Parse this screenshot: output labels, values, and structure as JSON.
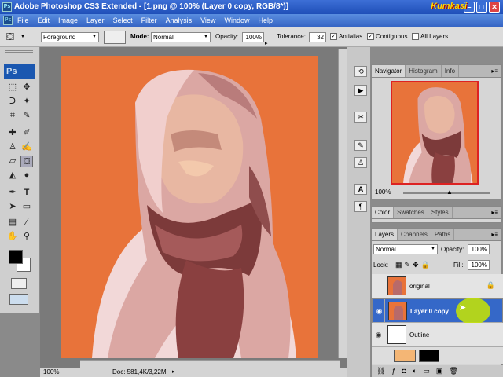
{
  "window": {
    "title": "Adobe Photoshop CS3 Extended - [1.png @ 100% (Layer 0 copy, RGB/8*)]",
    "app_icon": "Ps",
    "watermark": "Kumkasi"
  },
  "menu": [
    "File",
    "Edit",
    "Image",
    "Layer",
    "Select",
    "Filter",
    "Analysis",
    "View",
    "Window",
    "Help"
  ],
  "options": {
    "fill_source": "Foreground",
    "mode_label": "Mode:",
    "mode_value": "Normal",
    "opacity_label": "Opacity:",
    "opacity_value": "100%",
    "tolerance_label": "Tolerance:",
    "tolerance_value": "32",
    "antialias_label": "Antialias",
    "contiguous_label": "Contiguous",
    "all_layers_label": "All Layers"
  },
  "toolbox": {
    "logo": "Ps"
  },
  "document": {
    "zoom": "100%",
    "doc_info": "Doc: 581,4K/3,22M",
    "canvas_color": "#e8733a"
  },
  "navigator": {
    "tabs": [
      "Navigator",
      "Histogram",
      "Info"
    ],
    "zoom": "100%"
  },
  "color_panel": {
    "tabs": [
      "Color",
      "Swatches",
      "Styles"
    ]
  },
  "layers_panel": {
    "tabs": [
      "Layers",
      "Channels",
      "Paths"
    ],
    "blend_mode": "Normal",
    "opacity_label": "Opacity:",
    "opacity_value": "100%",
    "lock_label": "Lock:",
    "fill_label": "Fill:",
    "fill_value": "100%",
    "layers": [
      {
        "name": "original",
        "visible": false,
        "locked": true
      },
      {
        "name": "Layer 0 copy",
        "visible": true,
        "selected": true
      },
      {
        "name": "Outline",
        "visible": true
      }
    ]
  },
  "colors": {
    "selected_layer": "#3568c8",
    "canvas": "#e8733a",
    "titlebar": "#1f4fb8"
  }
}
